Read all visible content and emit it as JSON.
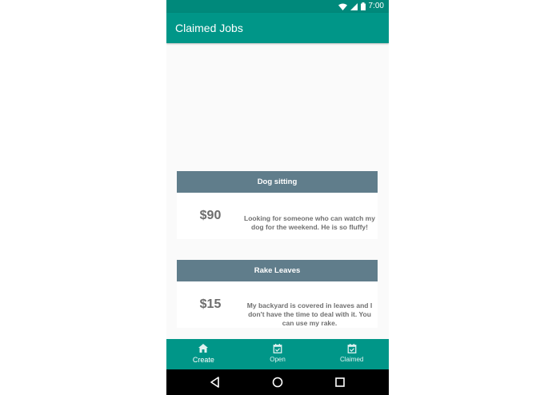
{
  "status_bar": {
    "time": "7:00",
    "icons": [
      "wifi-icon",
      "signal-icon",
      "battery-icon"
    ]
  },
  "app_bar": {
    "title": "Claimed Jobs"
  },
  "jobs": [
    {
      "title": "Dog sitting",
      "price": "$90",
      "description": "Looking for someone who can watch my dog for the weekend. He is so fluffy!"
    },
    {
      "title": "Rake Leaves",
      "price": "$15",
      "description": "My backyard is covered in leaves and I don't have the time to deal with it. You can use my rake."
    }
  ],
  "bottom_nav": {
    "items": [
      {
        "label": "Create",
        "icon": "home-icon",
        "active": true
      },
      {
        "label": "Open",
        "icon": "calendar-check-icon",
        "active": false
      },
      {
        "label": "Claimed",
        "icon": "calendar-check-icon",
        "active": false
      }
    ]
  },
  "system_nav": {
    "buttons": [
      "back-icon",
      "home-circle-icon",
      "recents-icon"
    ]
  },
  "colors": {
    "status_bar": "#00897b",
    "primary": "#009688",
    "card_header": "#607d8b",
    "background": "#fafafa"
  }
}
